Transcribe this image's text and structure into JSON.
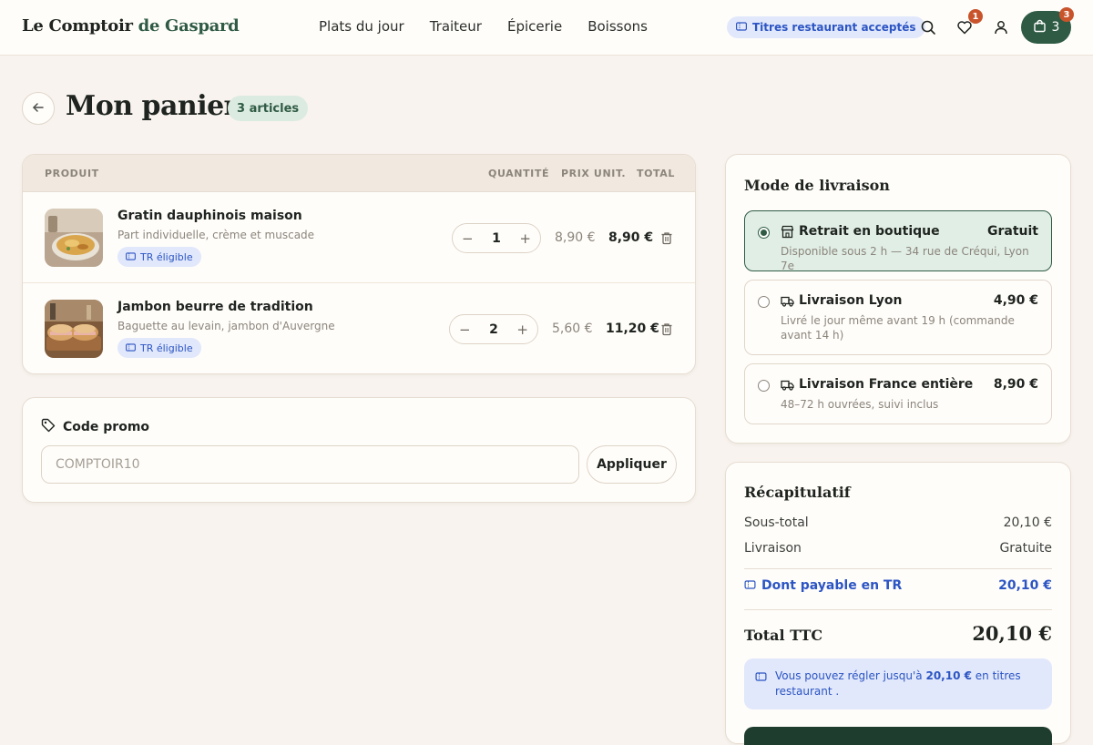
{
  "brand": {
    "part1": "Le Comptoir",
    "part2": "de Gaspard"
  },
  "nav": {
    "items": [
      "Plats du jour",
      "Traiteur",
      "Épicerie",
      "Boissons"
    ]
  },
  "header": {
    "tr_badge": "Titres restaurant acceptés",
    "wishlist_count": "1",
    "cart_count": "3",
    "cart_badge": "3"
  },
  "page": {
    "title": "Mon panier",
    "count": "3 articles"
  },
  "cart": {
    "columns": {
      "product": "PRODUIT",
      "quantity": "QUANTITÉ",
      "unit_price": "PRIX UNIT.",
      "total": "TOTAL"
    },
    "items": [
      {
        "name": "Gratin dauphinois maison",
        "description": "Part individuelle, crème et muscade",
        "tag": "TR éligible",
        "qty": "1",
        "unit": "8,90 €",
        "total": "8,90 €"
      },
      {
        "name": "Jambon beurre de tradition",
        "description": "Baguette au levain, jambon d'Auvergne",
        "tag": "TR éligible",
        "qty": "2",
        "unit": "5,60 €",
        "total": "11,20 €"
      }
    ]
  },
  "promo": {
    "title": "Code promo",
    "placeholder": "COMPTOIR10",
    "value": "",
    "apply": "Appliquer"
  },
  "delivery": {
    "title": "Mode de livraison",
    "options": [
      {
        "name": "Retrait en boutique",
        "price": "Gratuit",
        "desc": "Disponible sous 2 h — 34 rue de Créqui, Lyon 7e",
        "selected": true,
        "icon": "store-icon"
      },
      {
        "name": "Livraison Lyon",
        "price": "4,90 €",
        "desc": "Livré le jour même avant 19 h (commande avant 14 h)",
        "selected": false,
        "icon": "truck-icon"
      },
      {
        "name": "Livraison France entière",
        "price": "8,90 €",
        "desc": "48–72 h ouvrées, suivi inclus",
        "selected": false,
        "icon": "truck-icon"
      }
    ]
  },
  "summary": {
    "title": "Récapitulatif",
    "subtotal_label": "Sous-total",
    "subtotal": "20,10 €",
    "delivery_label": "Livraison",
    "delivery": "Gratuite",
    "tr_label": "Dont payable en TR",
    "tr_value": "20,10 €",
    "total_label": "Total TTC",
    "total": "20,10 €",
    "info_before": "Vous pouvez régler jusqu'à",
    "info_amount": "20,10 €",
    "info_after": "en titres restaurant ."
  },
  "colors": {
    "accent": "#2f5b44",
    "tr_blue": "#2c55c4",
    "tr_bg": "#e1e8fb",
    "badge": "#c9542c",
    "page_bg": "#f8f3ee"
  }
}
